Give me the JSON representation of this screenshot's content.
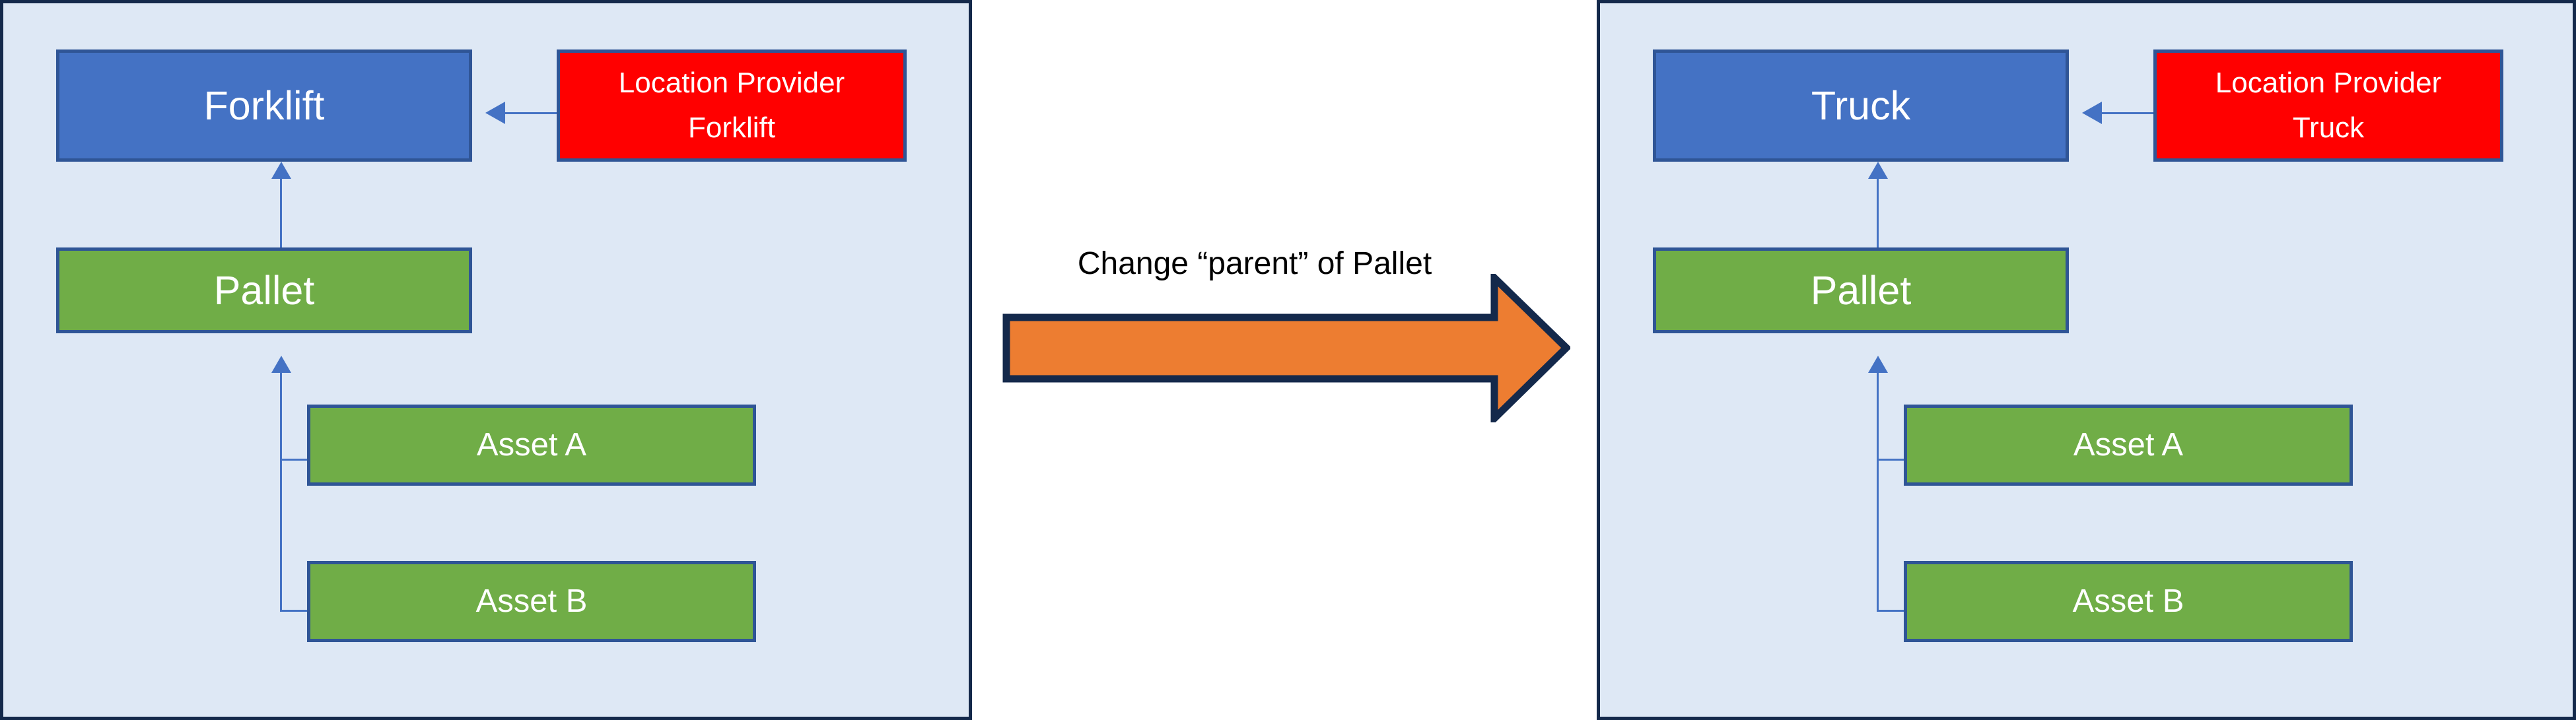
{
  "diagram": {
    "title_caption": "Change “parent” of Pallet",
    "colors": {
      "panel_background": "#DEE8F5",
      "panel_border": "#14294B",
      "node_blue": "#4472C4",
      "node_green": "#70AD47",
      "node_red": "#FF0000",
      "node_border": "#2F5596",
      "connector": "#4472C4",
      "arrow_fill": "#ED7D31",
      "arrow_border": "#14294B",
      "caption_text": "#000000",
      "node_text": "#FFFFFF"
    }
  },
  "panel_before": {
    "name": "before-state",
    "nodes": {
      "vehicle": "Forklift",
      "location_provider": "Location Provider\nForklift",
      "location_provider_line1": "Location Provider",
      "location_provider_line2": "Forklift",
      "pallet": "Pallet",
      "asset_a": "Asset A",
      "asset_b": "Asset B"
    }
  },
  "panel_after": {
    "name": "after-state",
    "nodes": {
      "vehicle": "Truck",
      "location_provider": "Location Provider\nTruck",
      "location_provider_line1": "Location Provider",
      "location_provider_line2": "Truck",
      "pallet": "Pallet",
      "asset_a": "Asset A",
      "asset_b": "Asset B"
    }
  },
  "transition": {
    "caption": "Change “parent” of Pallet",
    "direction": "right"
  }
}
